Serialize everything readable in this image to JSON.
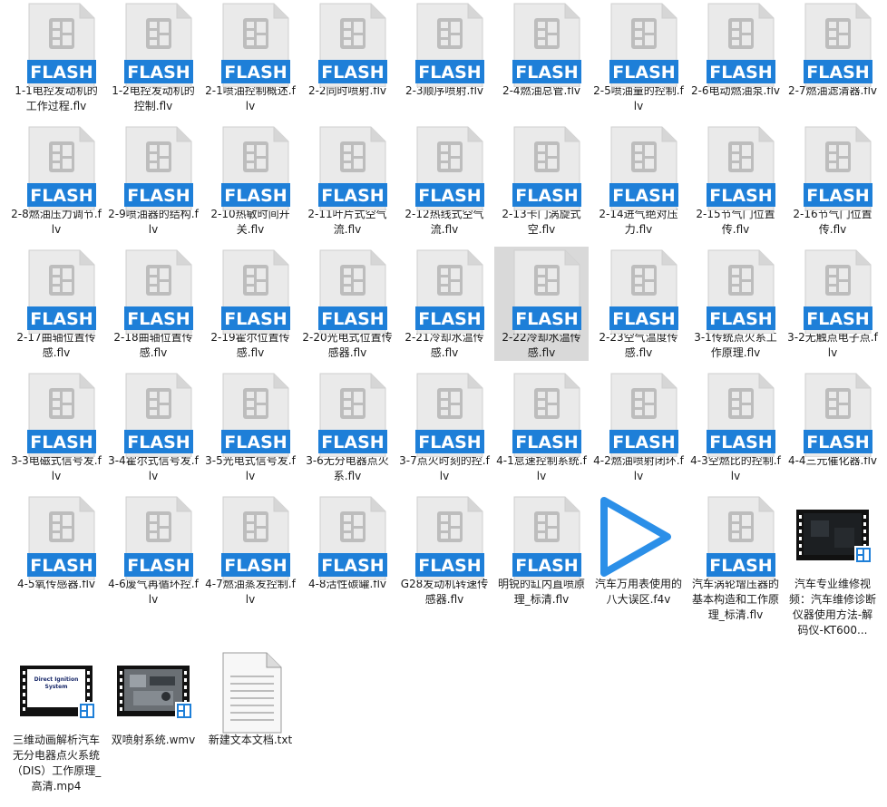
{
  "files": [
    {
      "name": "1-1电控发动机的工作过程.flv",
      "icon": "flash-file-icon",
      "badge": "FLASH"
    },
    {
      "name": "1-2电控发动机的控制.flv",
      "icon": "flash-file-icon",
      "badge": "FLASH"
    },
    {
      "name": "2-1喷油控制概述.flv",
      "icon": "flash-file-icon",
      "badge": "FLASH"
    },
    {
      "name": "2-2同时喷射.flv",
      "icon": "flash-file-icon",
      "badge": "FLASH"
    },
    {
      "name": "2-3顺序喷射.flv",
      "icon": "flash-file-icon",
      "badge": "FLASH"
    },
    {
      "name": "2-4燃油总管.flv",
      "icon": "flash-file-icon",
      "badge": "FLASH"
    },
    {
      "name": "2-5喷油量的控制.flv",
      "icon": "flash-file-icon",
      "badge": "FLASH"
    },
    {
      "name": "2-6电动燃油泵.flv",
      "icon": "flash-file-icon",
      "badge": "FLASH"
    },
    {
      "name": "2-7燃油滤清器.flv",
      "icon": "flash-file-icon",
      "badge": "FLASH"
    },
    {
      "name": "2-8燃油压力调节.flv",
      "icon": "flash-file-icon",
      "badge": "FLASH"
    },
    {
      "name": "2-9喷油器的结构.flv",
      "icon": "flash-file-icon",
      "badge": "FLASH"
    },
    {
      "name": "2-10热敏时间开关.flv",
      "icon": "flash-file-icon",
      "badge": "FLASH"
    },
    {
      "name": "2-11叶片式空气流.flv",
      "icon": "flash-file-icon",
      "badge": "FLASH"
    },
    {
      "name": "2-12热线式空气流.flv",
      "icon": "flash-file-icon",
      "badge": "FLASH"
    },
    {
      "name": "2-13卡门涡旋式空.flv",
      "icon": "flash-file-icon",
      "badge": "FLASH"
    },
    {
      "name": "2-14进气绝对压力.flv",
      "icon": "flash-file-icon",
      "badge": "FLASH"
    },
    {
      "name": "2-15节气门位置传.flv",
      "icon": "flash-file-icon",
      "badge": "FLASH"
    },
    {
      "name": "2-16节气门位置传.flv",
      "icon": "flash-file-icon",
      "badge": "FLASH"
    },
    {
      "name": "2-17曲轴位置传感.flv",
      "icon": "flash-file-icon",
      "badge": "FLASH"
    },
    {
      "name": "2-18曲轴位置传感.flv",
      "icon": "flash-file-icon",
      "badge": "FLASH"
    },
    {
      "name": "2-19霍尔位置传感.flv",
      "icon": "flash-file-icon",
      "badge": "FLASH"
    },
    {
      "name": "2-20光电式位置传感器.flv",
      "icon": "flash-file-icon",
      "badge": "FLASH"
    },
    {
      "name": "2-21冷却水温传感.flv",
      "icon": "flash-file-icon",
      "badge": "FLASH"
    },
    {
      "name": "2-22冷却水温传感.flv",
      "icon": "flash-file-icon",
      "badge": "FLASH",
      "selected": true
    },
    {
      "name": "2-23空气温度传感.flv",
      "icon": "flash-file-icon",
      "badge": "FLASH"
    },
    {
      "name": "3-1传统点火系工作原理.flv",
      "icon": "flash-file-icon",
      "badge": "FLASH"
    },
    {
      "name": "3-2无触点电子点.flv",
      "icon": "flash-file-icon",
      "badge": "FLASH"
    },
    {
      "name": "3-3电磁式信号发.flv",
      "icon": "flash-file-icon",
      "badge": "FLASH"
    },
    {
      "name": "3-4霍尔式信号发.flv",
      "icon": "flash-file-icon",
      "badge": "FLASH"
    },
    {
      "name": "3-5光电式信号发.flv",
      "icon": "flash-file-icon",
      "badge": "FLASH"
    },
    {
      "name": "3-6无分电器点火系.flv",
      "icon": "flash-file-icon",
      "badge": "FLASH"
    },
    {
      "name": "3-7点火时刻的控.flv",
      "icon": "flash-file-icon",
      "badge": "FLASH"
    },
    {
      "name": "4-1怠速控制系统.flv",
      "icon": "flash-file-icon",
      "badge": "FLASH"
    },
    {
      "name": "4-2燃油喷射闭环.flv",
      "icon": "flash-file-icon",
      "badge": "FLASH"
    },
    {
      "name": "4-3空燃比的控制.flv",
      "icon": "flash-file-icon",
      "badge": "FLASH"
    },
    {
      "name": "4-4三元催化器.flv",
      "icon": "flash-file-icon",
      "badge": "FLASH"
    },
    {
      "name": "4-5氧传感器.flv",
      "icon": "flash-file-icon",
      "badge": "FLASH"
    },
    {
      "name": "4-6废气再循环控.flv",
      "icon": "flash-file-icon",
      "badge": "FLASH"
    },
    {
      "name": "4-7燃油蒸发控制.flv",
      "icon": "flash-file-icon",
      "badge": "FLASH"
    },
    {
      "name": "4-8活性碳罐.flv",
      "icon": "flash-file-icon",
      "badge": "FLASH"
    },
    {
      "name": "G28发动机转速传感器.flv",
      "icon": "flash-file-icon",
      "badge": "FLASH"
    },
    {
      "name": "明锐的缸内直喷原理_标清.flv",
      "icon": "flash-file-icon",
      "badge": "FLASH"
    },
    {
      "name": "汽车万用表使用的八大误区.f4v",
      "icon": "play-icon"
    },
    {
      "name": "汽车涡轮增压器的基本构造和工作原理_标清.flv",
      "icon": "flash-file-icon",
      "badge": "FLASH"
    },
    {
      "name": "汽车专业维修视频：汽车维修诊断仪器使用方法-解码仪-KT600...",
      "icon": "video-thumbnail-icon",
      "thumb": "dark"
    },
    {
      "name": "三维动画解析汽车无分电器点火系统（DIS）工作原理_高清.mp4",
      "icon": "video-thumbnail-icon",
      "thumb": "slide",
      "thumb_text": "Direct Ignition System"
    },
    {
      "name": "双喷射系统.wmv",
      "icon": "video-thumbnail-icon",
      "thumb": "engine"
    },
    {
      "name": "新建文本文档.txt",
      "icon": "text-file-icon"
    }
  ]
}
